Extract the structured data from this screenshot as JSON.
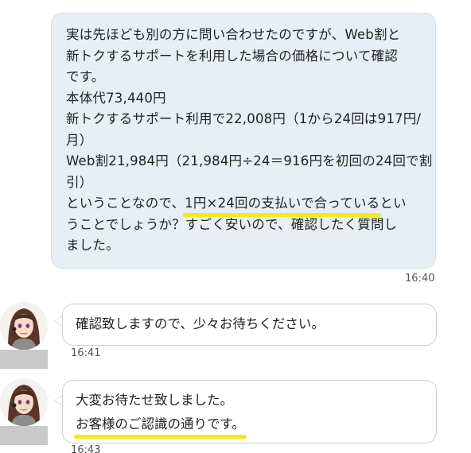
{
  "user_message": {
    "lines": [
      "実は先ほども別の方に問い合わせたのですが、Web割と",
      "新トクするサポートを利用した場合の価格について確認",
      "です。",
      "本体代73,440円",
      "新トクするサポート利用で22,008円（1から24回は917円/",
      "月）",
      "Web割21,984円（21,984円÷24＝916円を初回の24回で割",
      "引）",
      "ということなので、",
      "1円×24回の支払いで合っている",
      "とい",
      "うことでしょうか？すごく安いので、確認したく質問し",
      "ました。"
    ],
    "time": "16:40"
  },
  "operator_messages": [
    {
      "lines": [
        "確認致しますので、少々お待ちください。"
      ],
      "time": "16:41"
    },
    {
      "lines": [
        "大変お待たせ致しました。",
        "お客様のご認識の通りです。"
      ],
      "time": "16:43"
    }
  ],
  "colors": {
    "user_bubble": "#e8eef5",
    "highlight": "#f5ea17"
  },
  "icons": [
    "operator-avatar"
  ]
}
